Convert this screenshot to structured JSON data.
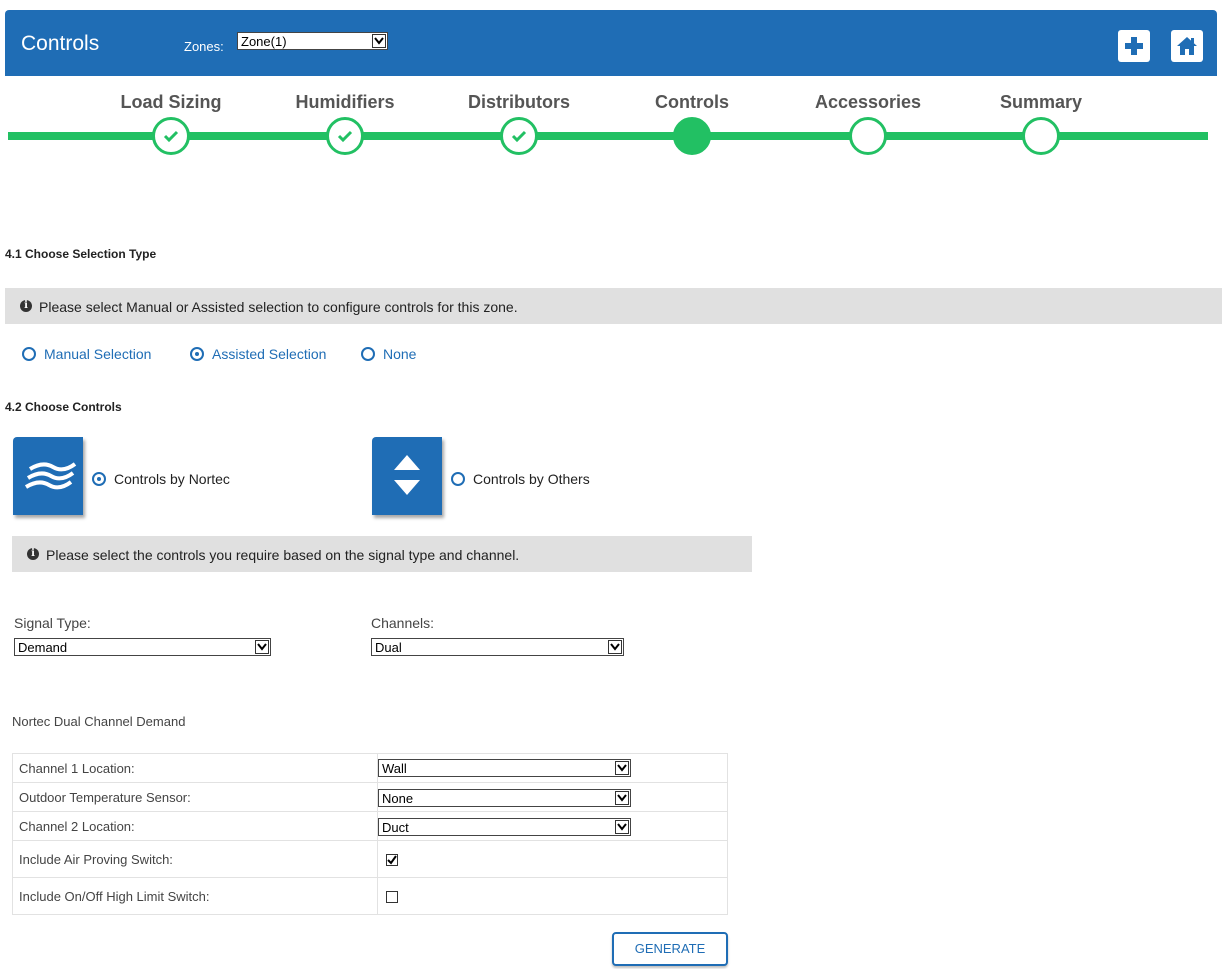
{
  "header": {
    "title": "Controls",
    "zones_label": "Zones:",
    "zone_selected": "Zone(1)"
  },
  "icons": {
    "add": "plus-icon",
    "home": "home-icon"
  },
  "colors": {
    "brand_blue": "#1f6db5",
    "step_green": "#22c063"
  },
  "steps": [
    {
      "label": "Load Sizing",
      "state": "complete"
    },
    {
      "label": "Humidifiers",
      "state": "complete"
    },
    {
      "label": "Distributors",
      "state": "complete"
    },
    {
      "label": "Controls",
      "state": "active"
    },
    {
      "label": "Accessories",
      "state": "pending"
    },
    {
      "label": "Summary",
      "state": "pending"
    }
  ],
  "section1": {
    "heading": "4.1 Choose Selection Type",
    "info": "Please select Manual or Assisted selection to configure controls for this zone.",
    "options": [
      "Manual Selection",
      "Assisted Selection",
      "None"
    ],
    "selected": "Assisted Selection"
  },
  "section2": {
    "heading": "4.2 Choose Controls",
    "option_nortec": "Controls by Nortec",
    "option_others": "Controls by Others",
    "selected": "Controls by Nortec",
    "info": "Please select the controls you require based on the signal type and channel."
  },
  "filters": {
    "signal_label": "Signal Type:",
    "signal_value": "Demand",
    "channels_label": "Channels:",
    "channels_value": "Dual"
  },
  "config": {
    "title": "Nortec Dual Channel Demand",
    "rows": [
      {
        "label": "Channel 1 Location:",
        "value": "Wall"
      },
      {
        "label": "Outdoor Temperature Sensor:",
        "value": "None"
      },
      {
        "label": "Channel 2 Location:",
        "value": "Duct"
      },
      {
        "label": "Include Air Proving Switch:",
        "checked": true
      },
      {
        "label": "Include On/Off High Limit Switch:",
        "checked": false
      }
    ],
    "generate_label": "GENERATE"
  }
}
